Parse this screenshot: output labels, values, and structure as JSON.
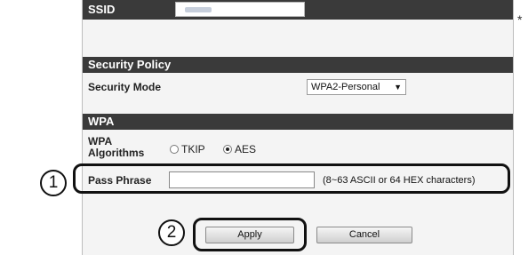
{
  "ssid": {
    "label": "SSID",
    "value": ""
  },
  "security_policy": {
    "header": "Security Policy",
    "mode_label": "Security Mode",
    "mode_value": "WPA2-Personal"
  },
  "wpa": {
    "header": "WPA",
    "algorithms_label_line1": "WPA",
    "algorithms_label_line2": "Algorithms",
    "options": [
      {
        "label": "TKIP",
        "selected": false
      },
      {
        "label": "AES",
        "selected": true
      }
    ],
    "pass_phrase_label": "Pass Phrase",
    "pass_phrase_value": "",
    "pass_phrase_hint": "(8~63 ASCII or 64 HEX characters)"
  },
  "buttons": {
    "apply": "Apply",
    "cancel": "Cancel"
  },
  "annotations": {
    "step1": "1",
    "step2": "2",
    "asterisk": "*"
  }
}
